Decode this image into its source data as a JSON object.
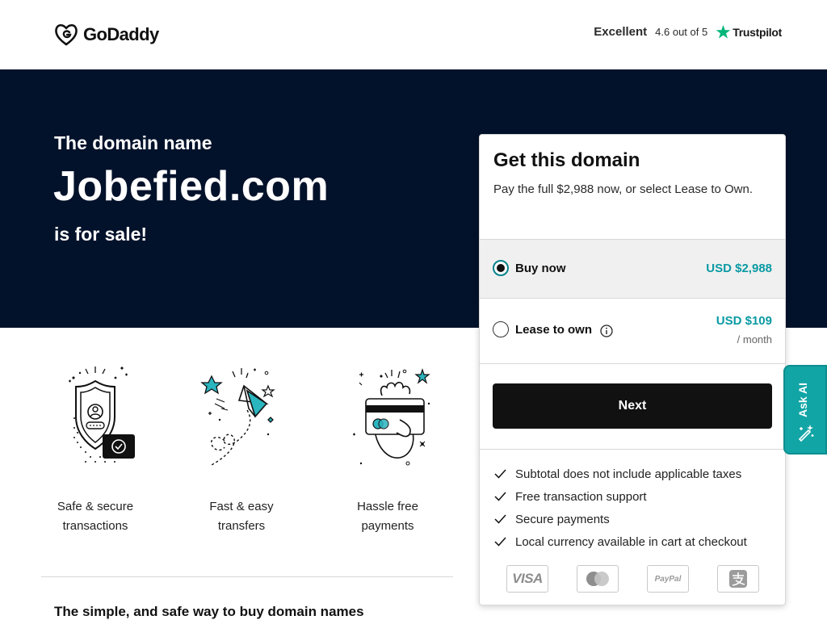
{
  "header": {
    "logo_text": "GoDaddy",
    "rating_word": "Excellent",
    "rating_score": "4.6 out of 5",
    "review_brand": "Trustpilot"
  },
  "hero": {
    "pre": "The domain name",
    "domain": "Jobefied.com",
    "post": "is for sale!"
  },
  "features": [
    {
      "icon": "shield-secure-icon",
      "line1": "Safe & secure",
      "line2": "transactions"
    },
    {
      "icon": "paper-plane-icon",
      "line1": "Fast & easy",
      "line2": "transfers"
    },
    {
      "icon": "hand-card-icon",
      "line1": "Hassle free",
      "line2": "payments"
    }
  ],
  "bottom_title": "The simple, and safe way to buy domain names",
  "card": {
    "title": "Get this domain",
    "subtitle": "Pay the full $2,988 now, or select Lease to Own.",
    "buy": {
      "label": "Buy now",
      "price": "USD $2,988",
      "selected": true
    },
    "lease": {
      "label": "Lease to own",
      "price": "USD $109",
      "unit": "/ month",
      "selected": false
    },
    "next_label": "Next",
    "benefits": [
      "Subtotal does not include applicable taxes",
      "Free transaction support",
      "Secure payments",
      "Local currency available in cart at checkout"
    ],
    "payments": [
      "visa",
      "mastercard",
      "paypal",
      "alipay"
    ],
    "visa_text": "VISA",
    "paypal_text": "PayPal"
  },
  "ask_ai": {
    "label": "Ask AI"
  },
  "colors": {
    "hero_bg": "#03122b",
    "accent": "#0a9aa3",
    "button": "#111111",
    "star": "#00b67a",
    "askai": "#12a5a6"
  }
}
